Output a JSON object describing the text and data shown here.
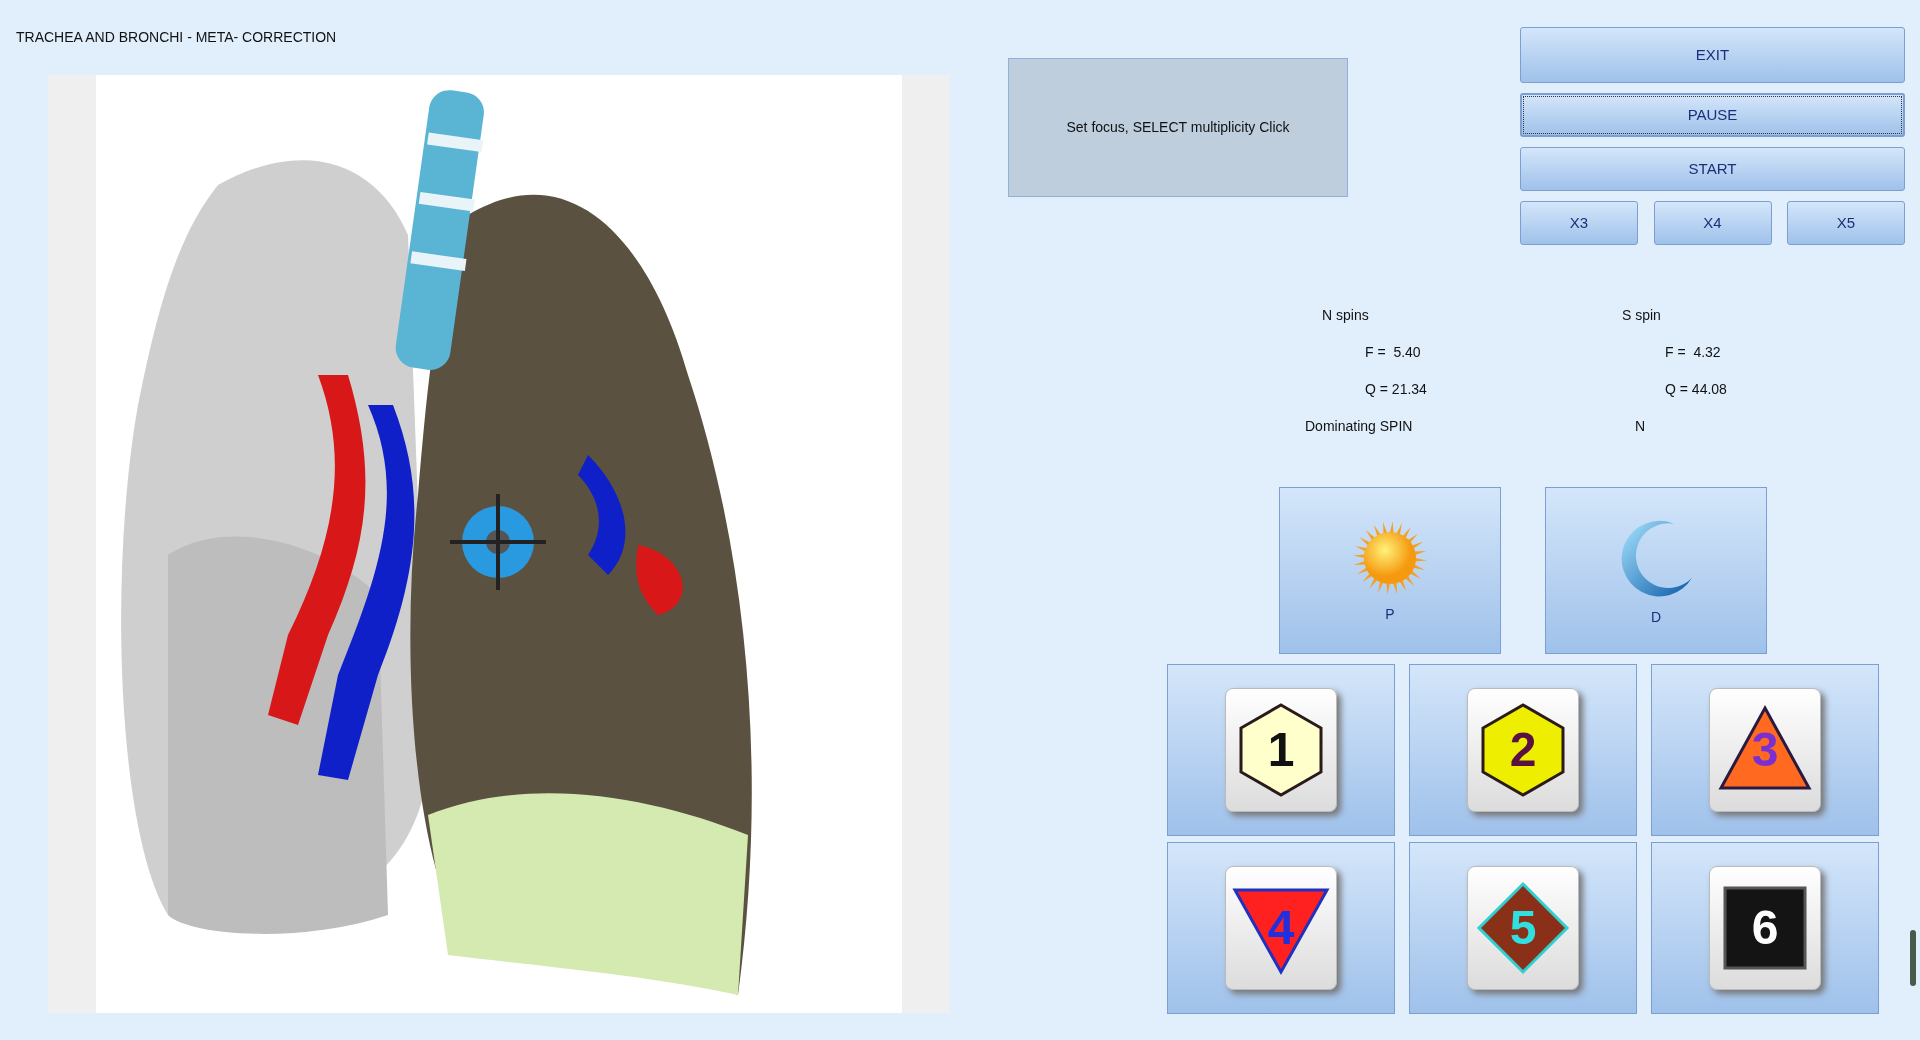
{
  "title": "TRACHEA AND BRONCHI - META- CORRECTION",
  "status_message": "Set focus, SELECT multiplicity Click",
  "controls": [
    {
      "label": "EXIT",
      "focused": false
    },
    {
      "label": "PAUSE",
      "focused": true
    },
    {
      "label": "START",
      "focused": false
    }
  ],
  "multipliers": [
    {
      "label": "X3"
    },
    {
      "label": "X4"
    },
    {
      "label": "X5"
    }
  ],
  "spins": [
    {
      "heading": "N spins",
      "f": "F =  5.40",
      "q": "Q = 21.34"
    },
    {
      "heading": "S spin",
      "f": "F =  4.32",
      "q": "Q = 44.08"
    }
  ],
  "dominating": {
    "label": "Dominating SPIN",
    "value": "N"
  },
  "modes": [
    {
      "label": "P",
      "kind": "sun"
    },
    {
      "label": "D",
      "kind": "moon"
    }
  ],
  "multiplicity": [
    {
      "label": "1",
      "kind": "hexagon",
      "color": "#ffffcc"
    },
    {
      "label": "2",
      "kind": "hexagon",
      "color": "#eeee00"
    },
    {
      "label": "3",
      "kind": "triangle",
      "color": "#ff6a20"
    },
    {
      "label": "4",
      "kind": "inverted-triangle",
      "color": "#ff2020"
    },
    {
      "label": "5",
      "kind": "diamond",
      "color": "#8b3018"
    },
    {
      "label": "6",
      "kind": "square",
      "color": "#141414"
    }
  ]
}
